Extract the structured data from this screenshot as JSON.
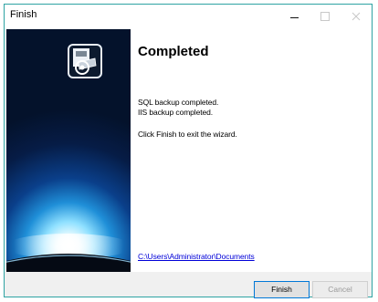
{
  "window": {
    "title": "Finish"
  },
  "content": {
    "heading": "Completed",
    "messages": [
      "SQL backup completed.",
      "IIS backup completed.",
      "Click Finish to exit the wizard."
    ],
    "path_link": "C:\\Users\\Administrator\\Documents"
  },
  "buttons": {
    "finish": "Finish",
    "cancel": "Cancel"
  },
  "icons": {
    "minimize": "minimize-icon",
    "maximize": "maximize-icon",
    "close": "close-icon",
    "logo": "backup-drive-icon"
  },
  "colors": {
    "window_border": "#2ea3a3",
    "link": "#0000d8",
    "default_button_border": "#0078d7",
    "banner_dark": "#04122b"
  }
}
